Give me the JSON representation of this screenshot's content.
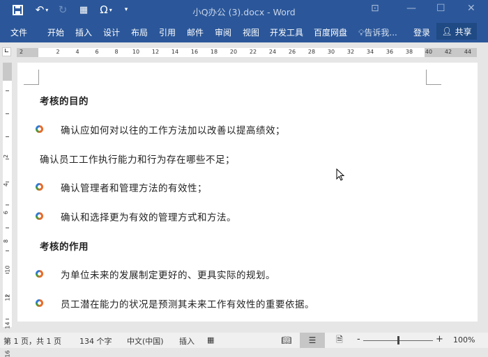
{
  "window": {
    "title": "小Q办公 (3).docx - Word"
  },
  "quick_access": {
    "save": "save-icon",
    "undo": "undo-icon",
    "redo": "redo-icon",
    "special": "Ω"
  },
  "ribbon": {
    "tabs": [
      "文件",
      "开始",
      "插入",
      "设计",
      "布局",
      "引用",
      "邮件",
      "审阅",
      "视图",
      "开发工具",
      "百度网盘"
    ],
    "tell_me": "告诉我...",
    "login": "登录",
    "share": "共享"
  },
  "ruler": {
    "h_ticks": [
      "2",
      "2",
      "4",
      "6",
      "8",
      "10",
      "12",
      "14",
      "16",
      "18",
      "20",
      "22",
      "24",
      "26",
      "28",
      "30",
      "32",
      "34",
      "36",
      "38",
      "40",
      "42",
      "44"
    ],
    "v_ticks": [
      "2",
      "4",
      "6",
      "8",
      "10",
      "12",
      "14",
      "16"
    ]
  },
  "document": {
    "lines": [
      {
        "text": "考核的目的",
        "heading": true,
        "bullet": false
      },
      {
        "text": "确认应如何对以往的工作方法加以改善以提高绩效；",
        "heading": false,
        "bullet": true
      },
      {
        "text": "确认员工工作执行能力和行为存在哪些不足；",
        "heading": false,
        "bullet": false
      },
      {
        "text": "确认管理者和管理方法的有效性；",
        "heading": false,
        "bullet": true
      },
      {
        "text": "确认和选择更为有效的管理方式和方法。",
        "heading": false,
        "bullet": true
      },
      {
        "text": "考核的作用",
        "heading": true,
        "bullet": false
      },
      {
        "text": "为单位未来的发展制定更好的、更具实际的规划。",
        "heading": false,
        "bullet": true
      },
      {
        "text": "员工潜在能力的状况是预测其未来工作有效性的重要依据。",
        "heading": false,
        "bullet": true
      }
    ]
  },
  "status": {
    "page": "第 1 页，共 1 页",
    "words": "134 个字",
    "language": "中文(中国)",
    "mode": "插入",
    "zoom": "100%",
    "zoom_percent": 100
  },
  "colors": {
    "brand": "#2b579a"
  }
}
